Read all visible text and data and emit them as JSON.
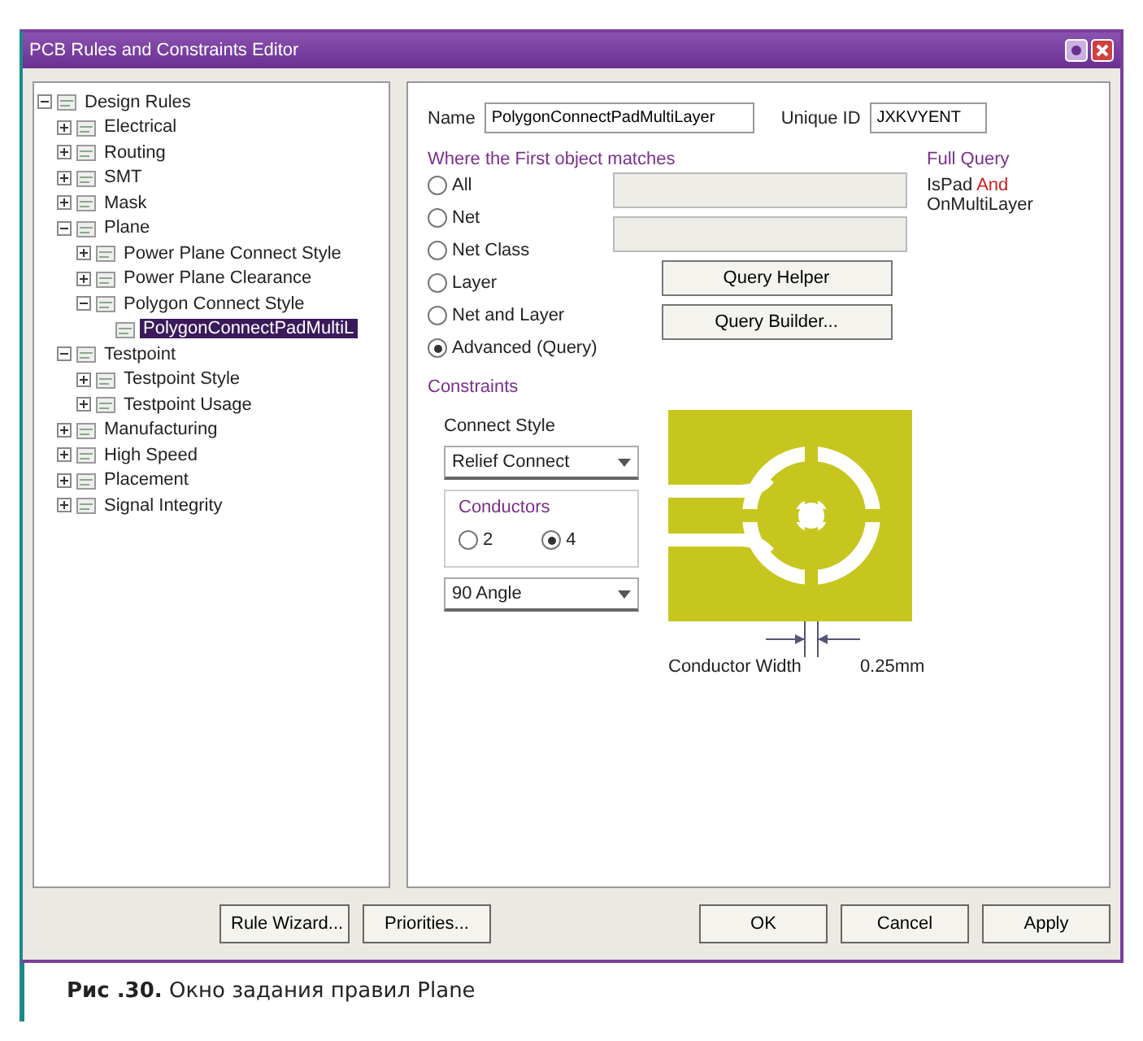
{
  "window": {
    "title": "PCB Rules and Constraints Editor"
  },
  "tree": [
    {
      "label": "Design Rules",
      "expanded": true,
      "selected": false,
      "children": [
        {
          "label": "Electrical",
          "expanded": false,
          "selected": false
        },
        {
          "label": "Routing",
          "expanded": false,
          "selected": false
        },
        {
          "label": "SMT",
          "expanded": false,
          "selected": false
        },
        {
          "label": "Mask",
          "expanded": false,
          "selected": false
        },
        {
          "label": "Plane",
          "expanded": true,
          "selected": false,
          "children": [
            {
              "label": "Power Plane Connect Style",
              "expanded": false,
              "selected": false
            },
            {
              "label": "Power Plane Clearance",
              "expanded": false,
              "selected": false
            },
            {
              "label": "Polygon Connect Style",
              "expanded": true,
              "selected": false,
              "children": [
                {
                  "label": "PolygonConnectPadMultiL",
                  "selected": true
                }
              ]
            }
          ]
        },
        {
          "label": "Testpoint",
          "expanded": true,
          "selected": false,
          "children": [
            {
              "label": "Testpoint Style",
              "expanded": false,
              "selected": false
            },
            {
              "label": "Testpoint Usage",
              "expanded": false,
              "selected": false
            }
          ]
        },
        {
          "label": "Manufacturing",
          "expanded": false,
          "selected": false
        },
        {
          "label": "High Speed",
          "expanded": false,
          "selected": false
        },
        {
          "label": "Placement",
          "expanded": false,
          "selected": false
        },
        {
          "label": "Signal Integrity",
          "expanded": false,
          "selected": false
        }
      ]
    }
  ],
  "rule": {
    "name_label": "Name",
    "name": "PolygonConnectPadMultiLayer",
    "id_label": "Unique ID",
    "id": "JXKVYENT"
  },
  "match": {
    "title": "Where the First object matches",
    "options": [
      {
        "label": "All",
        "selected": false
      },
      {
        "label": "Net",
        "selected": false
      },
      {
        "label": "Net Class",
        "selected": false
      },
      {
        "label": "Layer",
        "selected": false
      },
      {
        "label": "Net and Layer",
        "selected": false
      },
      {
        "label": "Advanced (Query)",
        "selected": true
      }
    ],
    "buttons": [
      "Query Helper",
      "Query Builder..."
    ],
    "query_title": "Full Query",
    "query": "IsPad **And**\nOnMultiLayer"
  },
  "constraints": {
    "title": "Constraints",
    "style_label": "Connect Style",
    "style": "Relief Connect",
    "conductors_title": "Conductors",
    "conductors": [
      {
        "label": "2",
        "selected": false
      },
      {
        "label": "4",
        "selected": true
      }
    ],
    "angle": "90 Angle",
    "width_label": "Conductor Width",
    "width": "0.25mm"
  },
  "buttons": [
    "Rule Wizard...",
    "Priorities...",
    "OK",
    "Cancel",
    "Apply"
  ],
  "caption": "**Рис .30.** Окно задания правил Plane"
}
